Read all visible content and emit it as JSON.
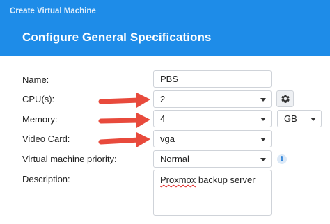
{
  "window": {
    "title": "Create Virtual Machine"
  },
  "section": {
    "title": "Configure General Specifications"
  },
  "form": {
    "name": {
      "label": "Name:",
      "value": "PBS"
    },
    "cpus": {
      "label": "CPU(s):",
      "value": "2"
    },
    "memory": {
      "label": "Memory:",
      "value": "4",
      "unit": "GB"
    },
    "video_card": {
      "label": "Video Card:",
      "value": "vga"
    },
    "priority": {
      "label": "Virtual machine priority:",
      "value": "Normal"
    },
    "description": {
      "label": "Description:",
      "value_word1": "Proxmox",
      "value_rest": " backup server"
    }
  },
  "icons": {
    "gear": "gear-icon",
    "info": "info-icon",
    "arrow": "red-arrow-icon"
  },
  "colors": {
    "header": "#1e8ce8",
    "arrow": "#e84a3c",
    "info": "#1e7ad6"
  }
}
